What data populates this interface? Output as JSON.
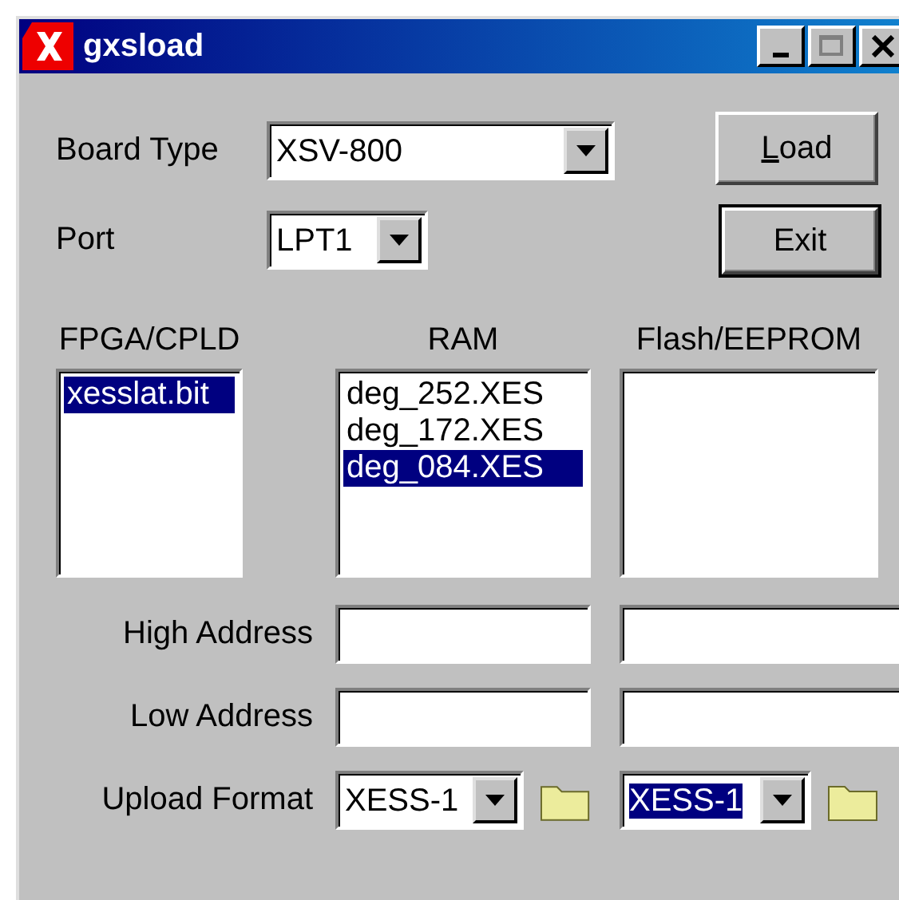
{
  "window": {
    "title": "gxsload"
  },
  "board_type": {
    "label": "Board Type",
    "value": "XSV-800"
  },
  "port": {
    "label": "Port",
    "value": "LPT1"
  },
  "buttons": [
    {
      "label": "Load",
      "mnemonic": true,
      "default": false
    },
    {
      "label": "Exit",
      "mnemonic": false,
      "default": true
    }
  ],
  "lists": [
    {
      "header": "FPGA/CPLD",
      "items": [
        {
          "text": "xesslat.bit",
          "selected": true
        }
      ]
    },
    {
      "header": "RAM",
      "items": [
        {
          "text": "deg_252.XES",
          "selected": false
        },
        {
          "text": "deg_172.XES",
          "selected": false
        },
        {
          "text": "deg_084.XES",
          "selected": true
        }
      ]
    },
    {
      "header": "Flash/EEPROM"
    }
  ],
  "address_rows": [
    {
      "label": "High Address"
    },
    {
      "label": "Low Address"
    }
  ],
  "upload_format": {
    "label": "Upload Format",
    "combos": [
      {
        "value": "XESS-1",
        "selected": false
      },
      {
        "value": "XESS-1",
        "selected": true
      }
    ]
  }
}
